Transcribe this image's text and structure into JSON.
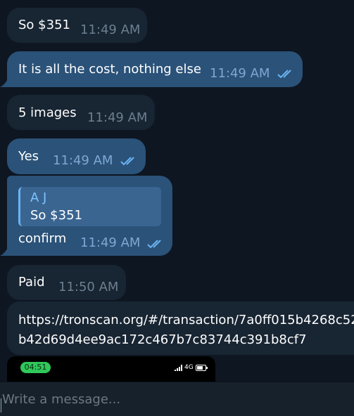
{
  "colors": {
    "background": "#0e1621",
    "incoming_bubble": "#182533",
    "outgoing_bubble": "#2b5278",
    "read_ticks": "#6ab3f3",
    "composer_bg": "#17212b"
  },
  "messages": [
    {
      "text": "So $351",
      "time": "11:49 AM",
      "direction": "incoming",
      "read": false
    },
    {
      "text": "It is all the cost, nothing else",
      "time": "11:49 AM",
      "direction": "outgoing",
      "read": true
    },
    {
      "text": "5 images",
      "time": "11:49 AM",
      "direction": "incoming",
      "read": false
    },
    {
      "text": "Yes",
      "time": "11:49 AM",
      "direction": "outgoing",
      "read": true
    },
    {
      "text": "confirm",
      "time": "11:49 AM",
      "direction": "outgoing",
      "read": true,
      "reply_to": {
        "name": "A J",
        "text": "So $351"
      }
    },
    {
      "text": "Paid",
      "time": "11:50 AM",
      "direction": "incoming",
      "read": false
    },
    {
      "direction": "incoming",
      "lines": [
        "https://tronscan.org/#/transaction/7a0ff015b4268c52",
        "b42d69d4ee9ac172c467b7c83744c391b8cf7"
      ]
    }
  ],
  "screenshot_preview": {
    "status_time": "04:51",
    "network": "4G",
    "icons": [
      "signal-icon",
      "battery-icon"
    ]
  },
  "composer": {
    "placeholder": "Write a message..."
  }
}
